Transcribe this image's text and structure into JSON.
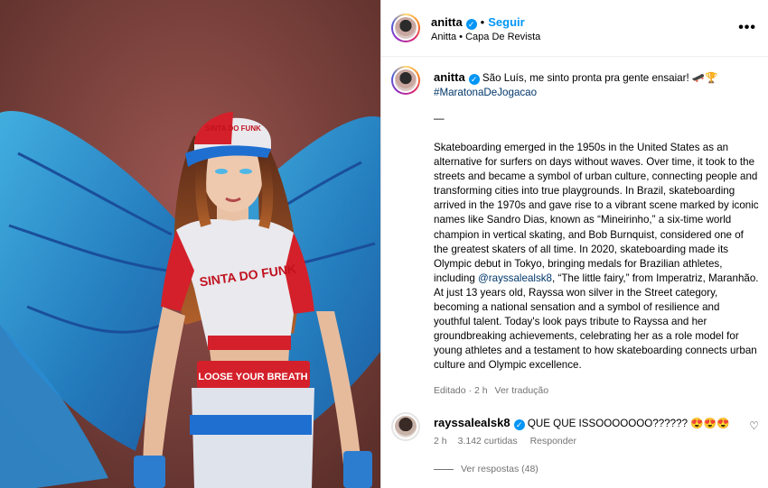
{
  "post": {
    "author": "anitta",
    "follow_label": "Seguir",
    "subtitle": "Anitta • Capa De Revista",
    "more_label": "•••"
  },
  "caption": {
    "username": "anitta",
    "first_line": "São Luís, me sinto pronta pra gente ensaiar! 🛹🏆",
    "hashtag": "#MaratonaDeJogacao",
    "separator": "—",
    "body_part1": "Skateboarding emerged in the 1950s in the United States as an alternative for surfers on days without waves. Over time, it took to the streets and became a symbol of urban culture, connecting people and transforming cities into true playgrounds. In Brazil, skateboarding arrived in the 1970s and gave rise to a vibrant scene marked by iconic names like Sandro Dias, known as “Mineirinho,” a six-time world champion in vertical skating, and Bob Burnquist, considered one of the greatest skaters of all time. In 2020, skateboarding made its Olympic debut in Tokyo, bringing medals for Brazilian athletes, including ",
    "mention": "@rayssalealsk8",
    "body_part2": ", “The little fairy,” from Imperatriz, Maranhão. At just 13 years old, Rayssa won silver in the Street category, becoming a national sensation and a symbol of resilience and youthful talent. Today's look pays tribute to Rayssa and her groundbreaking achievements, celebrating her as a role model for young athletes and a testament to how skateboarding connects urban culture and Olympic excellence.",
    "edited": "Editado · 2 h",
    "translate": "Ver tradução"
  },
  "comment": {
    "username": "rayssalealsk8",
    "text": "QUE QUE ISSOOOOOOO?????? 😍😍😍",
    "time": "2 h",
    "likes": "3.142 curtidas",
    "reply": "Responder",
    "view_replies": "Ver respostas (48)"
  },
  "photo": {
    "cap_text": "SINTA DO FUNK",
    "shirt_text": "SINTA DO FUNK",
    "waistband_text": "LOOSE YOUR BREATH"
  }
}
